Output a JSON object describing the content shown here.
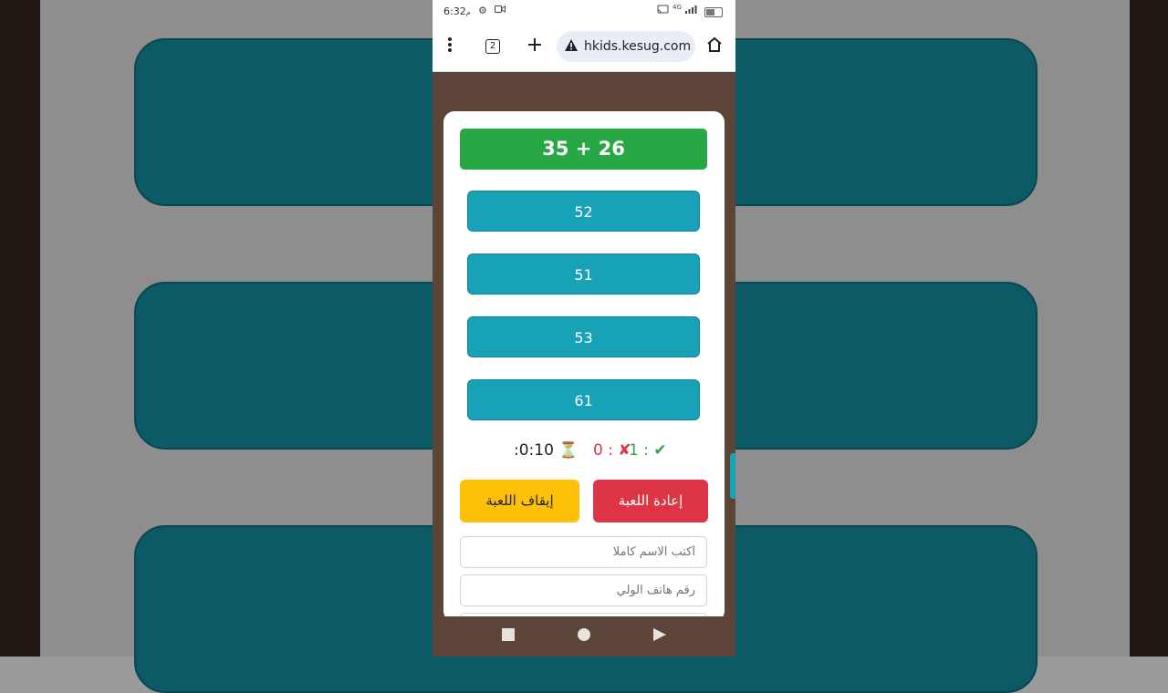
{
  "status_bar": {
    "time": "6:32",
    "ampm": "م",
    "icons": [
      "settings-icon",
      "video-icon",
      "cast-icon",
      "network-4g-icon",
      "signal-icon",
      "battery-icon"
    ]
  },
  "browser": {
    "tabs_count": "2",
    "url": "hkids.kesug.com",
    "icons": [
      "menu-dots-icon",
      "tabs-icon",
      "plus-icon",
      "warning-icon",
      "home-icon"
    ]
  },
  "game": {
    "question": "35 + 26",
    "answers": [
      "52",
      "51",
      "53",
      "61"
    ],
    "timer": ":0:10",
    "timer_icon": "hourglass-icon",
    "wrong_count": "0 :",
    "wrong_icon": "cross-icon",
    "right_count": "1 :",
    "right_icon": "check-icon",
    "stop_label": "إيقاف اللعبة",
    "restart_label": "إعادة اللعبة",
    "name_placeholder": "أكتب الاسم كاملا",
    "phone_placeholder": "رقم هاتف الولي"
  },
  "colors": {
    "question_bg": "#28a745",
    "answer_bg": "#17a2b8",
    "stop_bg": "#ffc107",
    "restart_bg": "#dc3545",
    "page_bg": "#5d4438"
  }
}
